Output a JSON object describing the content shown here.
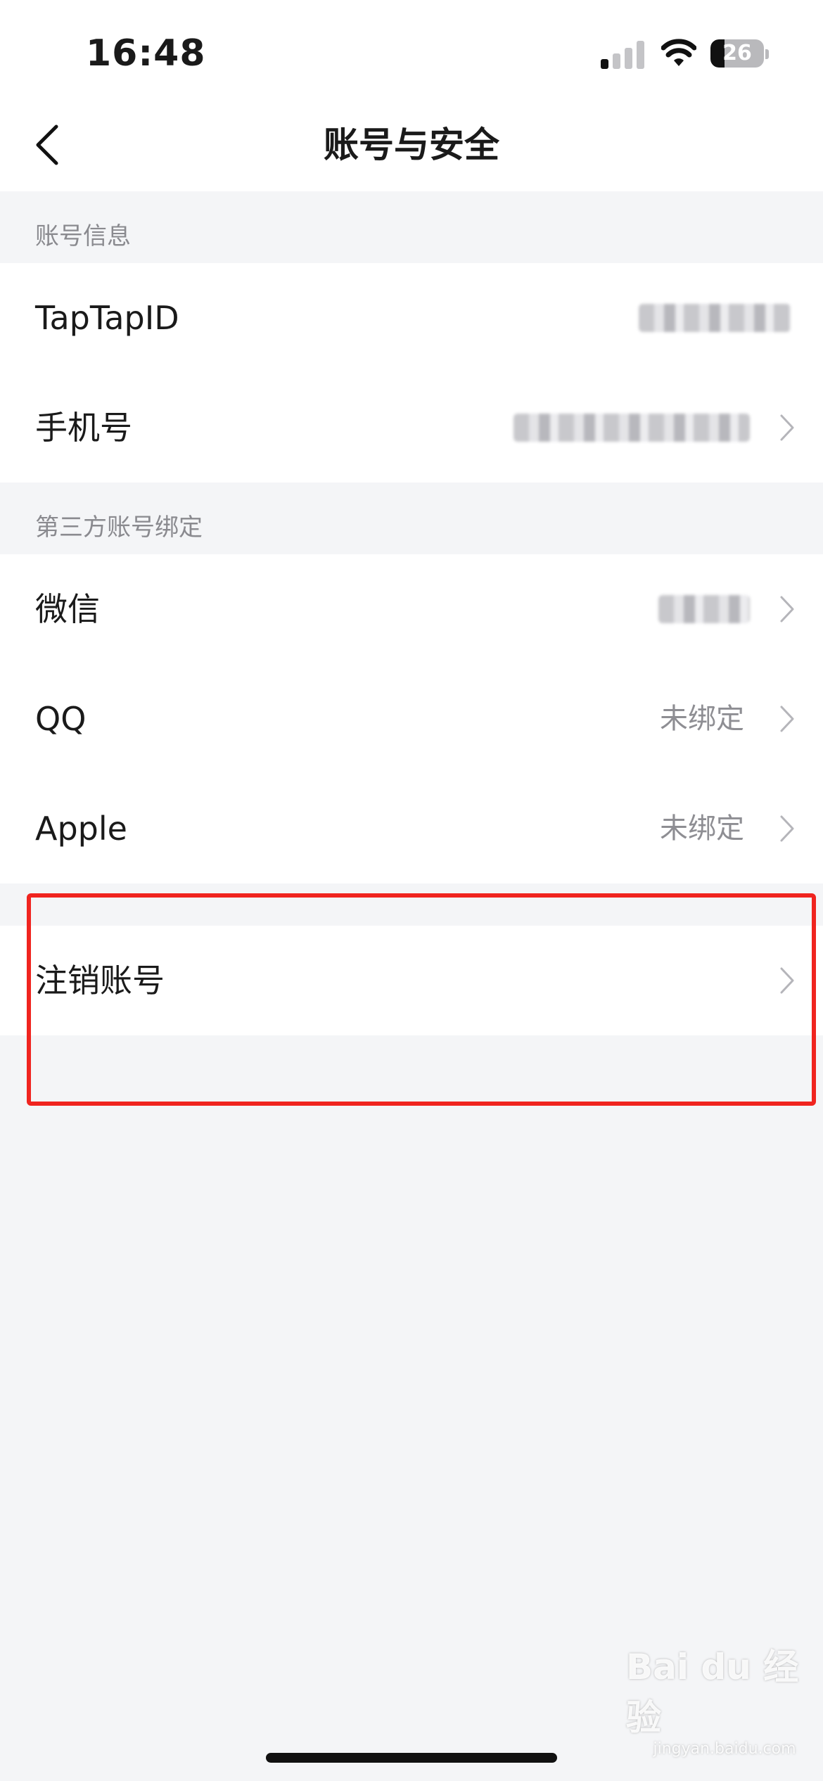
{
  "status_bar": {
    "time": "16:48",
    "battery": "26"
  },
  "nav": {
    "title": "账号与安全",
    "back_icon": "chevron-left-icon"
  },
  "sections": {
    "account_info": {
      "label": "账号信息"
    },
    "third_party": {
      "label": "第三方账号绑定"
    }
  },
  "rows": {
    "taptap_id": {
      "label": "TapTapID",
      "value": ""
    },
    "phone": {
      "label": "手机号",
      "value": ""
    },
    "wechat": {
      "label": "微信",
      "value": ""
    },
    "qq": {
      "label": "QQ",
      "value": "未绑定"
    },
    "apple": {
      "label": "Apple",
      "value": "未绑定"
    },
    "deactivate": {
      "label": "注销账号"
    }
  },
  "colors": {
    "highlight": "#f0241f",
    "background": "#f4f5f7",
    "secondary_text": "#8e8e93"
  },
  "watermark": {
    "text": "Bai du 经验",
    "sub": "jingyan.baidu.com"
  }
}
